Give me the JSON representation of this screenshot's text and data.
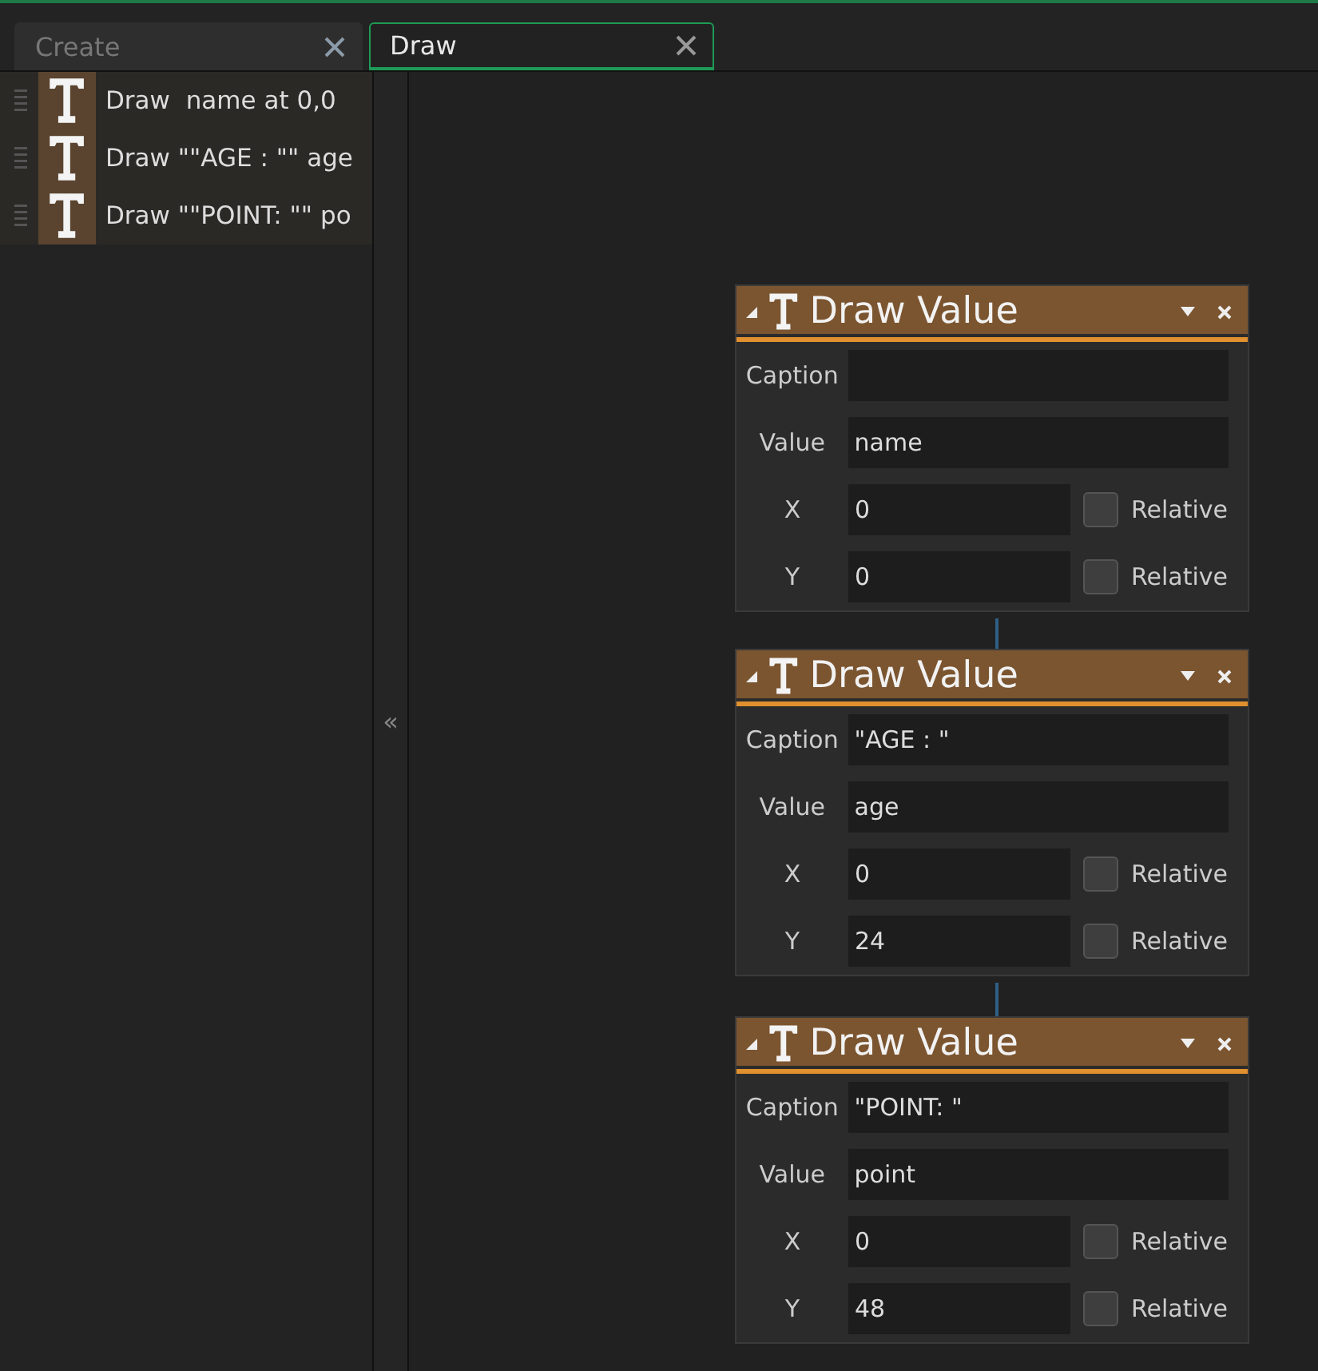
{
  "tabs": [
    {
      "label": "Create",
      "selected": false
    },
    {
      "label": "Draw",
      "selected": true
    }
  ],
  "actions": [
    {
      "label": "Draw  name at 0,0"
    },
    {
      "label": "Draw \"\"AGE : \"\" age"
    },
    {
      "label": "Draw \"\"POINT: \"\" po"
    }
  ],
  "splitter": {
    "label": "«"
  },
  "nodes": [
    {
      "title": "Draw Value",
      "fields": [
        {
          "label": "Caption"
        },
        {
          "label": "Value",
          "value": "name"
        },
        {
          "label": "X",
          "value": "0",
          "relative": {
            "label": "Relative",
            "checked": false
          }
        },
        {
          "label": "Y",
          "value": "0",
          "relative": {
            "label": "Relative",
            "checked": false
          }
        }
      ]
    },
    {
      "title": "Draw Value",
      "fields": [
        {
          "label": "Caption",
          "value": "\"AGE : \""
        },
        {
          "label": "Value",
          "value": "age"
        },
        {
          "label": "X",
          "value": "0",
          "relative": {
            "label": "Relative",
            "checked": false
          }
        },
        {
          "label": "Y",
          "value": "24",
          "relative": {
            "label": "Relative",
            "checked": false
          }
        }
      ]
    },
    {
      "title": "Draw Value",
      "fields": [
        {
          "label": "Caption",
          "value": "\"POINT: \""
        },
        {
          "label": "Value",
          "value": "point"
        },
        {
          "label": "X",
          "value": "0",
          "relative": {
            "label": "Relative",
            "checked": false
          }
        },
        {
          "label": "Y",
          "value": "48",
          "relative": {
            "label": "Relative",
            "checked": false
          }
        }
      ]
    }
  ]
}
